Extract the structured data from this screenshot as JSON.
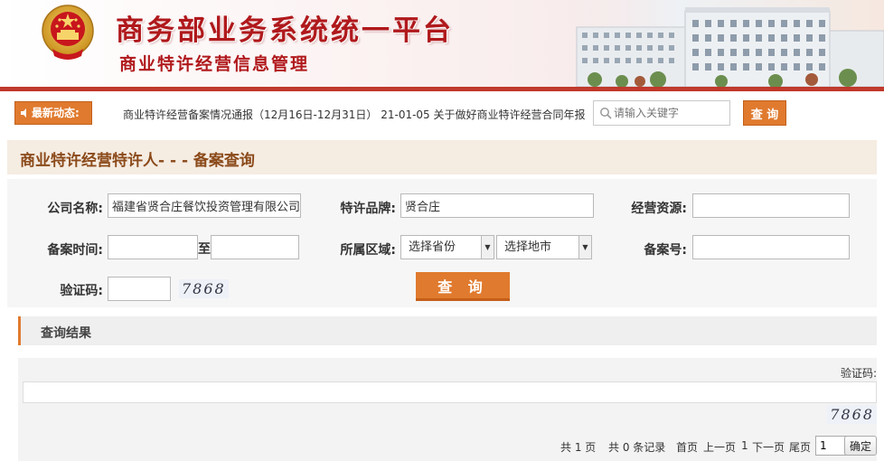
{
  "header": {
    "title": "商务部业务系统统一平台",
    "subtitle": "商业特许经营信息管理",
    "emblem_icon": "national-emblem-icon",
    "building_image": "ministry-building-image"
  },
  "news": {
    "badge_label": "最新动态:",
    "ticker_text": "商业特许经营备案情况通报（12月16日-12月31日） 21-01-05   关于做好商业特许经营合同年报工作的通知",
    "search_placeholder": "请输入关键字",
    "search_button": "查 询"
  },
  "page": {
    "heading": "商业特许经营特许人- - - 备案查询"
  },
  "form": {
    "company_label": "公司名称:",
    "company_value": "福建省贤合庄餐饮投资管理有限公司",
    "brand_label": "特许品牌:",
    "brand_value": "贤合庄",
    "resource_label": "经营资源:",
    "resource_value": "",
    "record_time_label": "备案时间:",
    "to_label": "至",
    "date_from": "",
    "date_to": "",
    "region_label": "所属区域:",
    "province_selected": "选择省份",
    "city_selected": "选择地市",
    "record_no_label": "备案号:",
    "record_no_value": "",
    "captcha_label": "验证码:",
    "captcha_value": "",
    "captcha_image_text": "7868",
    "query_button": "查 询"
  },
  "results": {
    "heading": "查询结果",
    "captcha_label": "验证码:",
    "captcha_image_text": "7868",
    "pager": {
      "total_pages": "共 1 页",
      "total_records": "共 0 条记录",
      "first": "首页",
      "prev": "上一页",
      "page_text": "1",
      "next": "下一页",
      "last": "尾页",
      "page_input": "1",
      "confirm": "确定"
    }
  },
  "colors": {
    "brand_red": "#b0191c",
    "accent_orange": "#e07a2e",
    "heading_brown": "#8b4a1a"
  }
}
